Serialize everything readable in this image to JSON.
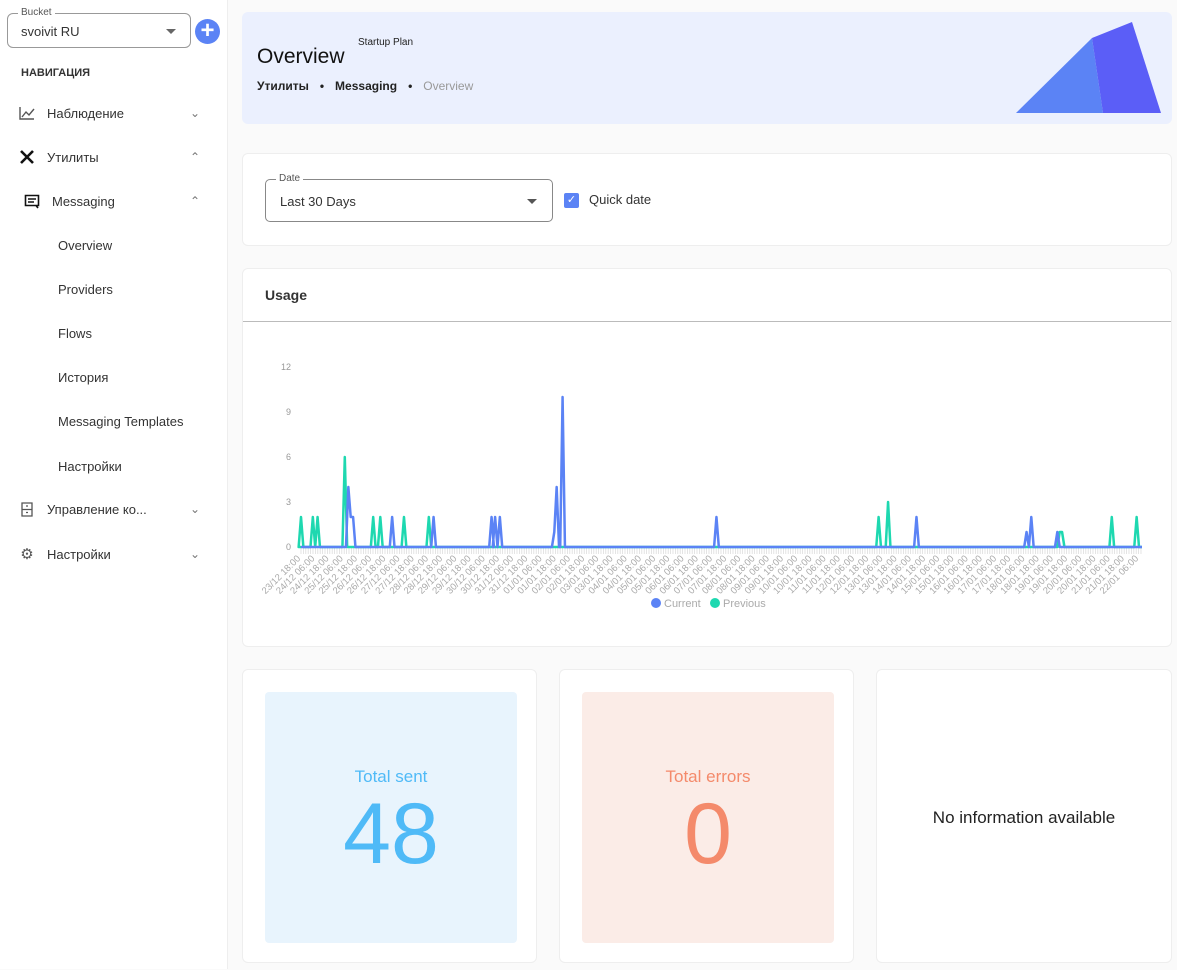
{
  "sidebar": {
    "bucket_label": "Bucket",
    "bucket_value": "svoivit RU",
    "add_icon": "plus-icon",
    "nav_heading": "НАВИГАЦИЯ",
    "items": [
      {
        "label": "Наблюдение",
        "icon": "chart-line-icon"
      },
      {
        "label": "Утилиты",
        "icon": "tools-icon"
      },
      {
        "label": "Messaging",
        "icon": "message-icon"
      },
      {
        "label": "Overview"
      },
      {
        "label": "Providers"
      },
      {
        "label": "Flows"
      },
      {
        "label": "История"
      },
      {
        "label": "Messaging Templates"
      },
      {
        "label": "Настройки"
      },
      {
        "label": "Управление ко...",
        "icon": "cabinet-icon"
      },
      {
        "label": "Настройки",
        "icon": "gears-icon"
      }
    ]
  },
  "header": {
    "title": "Overview",
    "plan": "Startup Plan",
    "breadcrumbs": [
      "Утилиты",
      "Messaging",
      "Overview"
    ]
  },
  "filter": {
    "date_label": "Date",
    "date_value": "Last 30 Days",
    "quick_date_label": "Quick date",
    "quick_date_checked": true
  },
  "usage": {
    "title": "Usage"
  },
  "chart_data": {
    "type": "line",
    "title": "",
    "xlabel": "",
    "ylabel": "",
    "ylim": [
      0,
      12
    ],
    "yticks": [
      0,
      3,
      6,
      9,
      12
    ],
    "grid": false,
    "legend": "bottom",
    "xticks": [
      "23/12 18:00",
      "24/12 06:00",
      "24/12 18:00",
      "25/12 06:00",
      "25/12 18:00",
      "26/12 06:00",
      "26/12 18:00",
      "27/12 06:00",
      "27/12 18:00",
      "28/12 06:00",
      "28/12 18:00",
      "29/12 06:00",
      "29/12 18:00",
      "30/12 06:00",
      "30/12 18:00",
      "31/12 06:00",
      "31/12 18:00",
      "01/01 06:00",
      "01/01 18:00",
      "02/01 06:00",
      "02/01 18:00",
      "03/01 06:00",
      "03/01 18:00",
      "04/01 06:00",
      "04/01 18:00",
      "05/01 06:00",
      "05/01 18:00",
      "06/01 06:00",
      "06/01 18:00",
      "07/01 06:00",
      "07/01 18:00",
      "08/01 06:00",
      "08/01 18:00",
      "09/01 06:00",
      "09/01 18:00",
      "10/01 06:00",
      "10/01 18:00",
      "11/01 06:00",
      "11/01 18:00",
      "12/01 06:00",
      "12/01 18:00",
      "13/01 06:00",
      "13/01 18:00",
      "14/01 06:00",
      "14/01 18:00",
      "15/01 06:00",
      "15/01 18:00",
      "16/01 06:00",
      "16/01 18:00",
      "17/01 06:00",
      "17/01 18:00",
      "18/01 06:00",
      "18/01 18:00",
      "19/01 06:00",
      "19/01 18:00",
      "20/01 06:00",
      "20/01 18:00",
      "21/01 06:00",
      "21/01 18:00",
      "22/01 06:00"
    ],
    "series": [
      {
        "name": "Current",
        "color": "#5b83f5",
        "points": [
          [
            "25/12 10:00",
            4
          ],
          [
            "25/12 12:00",
            2
          ],
          [
            "25/12 14:00",
            2
          ],
          [
            "26/12 23:00",
            2
          ],
          [
            "28/12 10:00",
            2
          ],
          [
            "30/12 11:00",
            2
          ],
          [
            "30/12 14:00",
            2
          ],
          [
            "30/12 18:00",
            2
          ],
          [
            "01/01 16:00",
            1
          ],
          [
            "01/01 18:00",
            4
          ],
          [
            "01/01 23:00",
            10
          ],
          [
            "07/01 09:00",
            2
          ],
          [
            "14/01 10:00",
            2
          ],
          [
            "18/01 07:00",
            1
          ],
          [
            "18/01 11:00",
            2
          ],
          [
            "19/01 09:00",
            1
          ]
        ]
      },
      {
        "name": "Previous",
        "color": "#1ed8b0",
        "points": [
          [
            "23/12 18:00",
            2
          ],
          [
            "24/12 04:00",
            2
          ],
          [
            "24/12 08:00",
            2
          ],
          [
            "25/12 07:00",
            6
          ],
          [
            "26/12 07:00",
            2
          ],
          [
            "26/12 13:00",
            2
          ],
          [
            "27/12 09:00",
            2
          ],
          [
            "28/12 06:00",
            2
          ],
          [
            "13/01 02:00",
            2
          ],
          [
            "13/01 10:00",
            3
          ],
          [
            "19/01 11:00",
            1
          ],
          [
            "19/01 13:00",
            1
          ],
          [
            "21/01 07:00",
            2
          ],
          [
            "22/01 04:00",
            2
          ]
        ]
      }
    ]
  },
  "stats": {
    "sent": {
      "label": "Total sent",
      "value": "48",
      "color": "#4fbaf7",
      "bg": "#e8f4fd"
    },
    "errors": {
      "label": "Total errors",
      "value": "0",
      "color": "#f48a6b",
      "bg": "#fbece7"
    },
    "empty": "No information available"
  }
}
